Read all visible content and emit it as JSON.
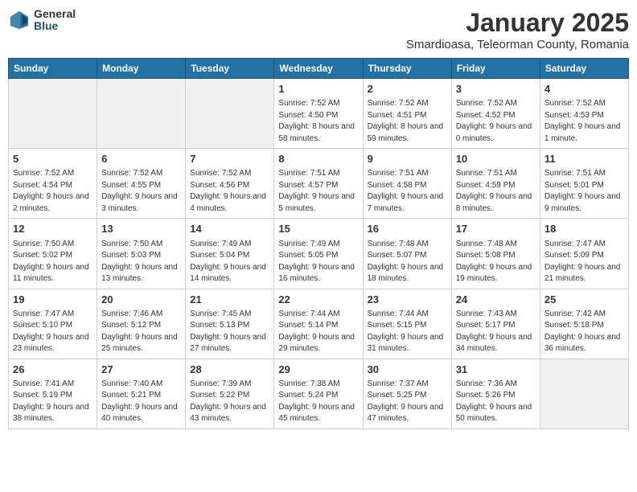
{
  "header": {
    "logo_general": "General",
    "logo_blue": "Blue",
    "month_title": "January 2025",
    "location": "Smardioasa, Teleorman County, Romania"
  },
  "weekdays": [
    "Sunday",
    "Monday",
    "Tuesday",
    "Wednesday",
    "Thursday",
    "Friday",
    "Saturday"
  ],
  "weeks": [
    [
      {
        "day": "",
        "info": ""
      },
      {
        "day": "",
        "info": ""
      },
      {
        "day": "",
        "info": ""
      },
      {
        "day": "1",
        "info": "Sunrise: 7:52 AM\nSunset: 4:50 PM\nDaylight: 8 hours and 58 minutes."
      },
      {
        "day": "2",
        "info": "Sunrise: 7:52 AM\nSunset: 4:51 PM\nDaylight: 8 hours and 59 minutes."
      },
      {
        "day": "3",
        "info": "Sunrise: 7:52 AM\nSunset: 4:52 PM\nDaylight: 9 hours and 0 minutes."
      },
      {
        "day": "4",
        "info": "Sunrise: 7:52 AM\nSunset: 4:53 PM\nDaylight: 9 hours and 1 minute."
      }
    ],
    [
      {
        "day": "5",
        "info": "Sunrise: 7:52 AM\nSunset: 4:54 PM\nDaylight: 9 hours and 2 minutes."
      },
      {
        "day": "6",
        "info": "Sunrise: 7:52 AM\nSunset: 4:55 PM\nDaylight: 9 hours and 3 minutes."
      },
      {
        "day": "7",
        "info": "Sunrise: 7:52 AM\nSunset: 4:56 PM\nDaylight: 9 hours and 4 minutes."
      },
      {
        "day": "8",
        "info": "Sunrise: 7:51 AM\nSunset: 4:57 PM\nDaylight: 9 hours and 5 minutes."
      },
      {
        "day": "9",
        "info": "Sunrise: 7:51 AM\nSunset: 4:58 PM\nDaylight: 9 hours and 7 minutes."
      },
      {
        "day": "10",
        "info": "Sunrise: 7:51 AM\nSunset: 4:59 PM\nDaylight: 9 hours and 8 minutes."
      },
      {
        "day": "11",
        "info": "Sunrise: 7:51 AM\nSunset: 5:01 PM\nDaylight: 9 hours and 9 minutes."
      }
    ],
    [
      {
        "day": "12",
        "info": "Sunrise: 7:50 AM\nSunset: 5:02 PM\nDaylight: 9 hours and 11 minutes."
      },
      {
        "day": "13",
        "info": "Sunrise: 7:50 AM\nSunset: 5:03 PM\nDaylight: 9 hours and 13 minutes."
      },
      {
        "day": "14",
        "info": "Sunrise: 7:49 AM\nSunset: 5:04 PM\nDaylight: 9 hours and 14 minutes."
      },
      {
        "day": "15",
        "info": "Sunrise: 7:49 AM\nSunset: 5:05 PM\nDaylight: 9 hours and 16 minutes."
      },
      {
        "day": "16",
        "info": "Sunrise: 7:48 AM\nSunset: 5:07 PM\nDaylight: 9 hours and 18 minutes."
      },
      {
        "day": "17",
        "info": "Sunrise: 7:48 AM\nSunset: 5:08 PM\nDaylight: 9 hours and 19 minutes."
      },
      {
        "day": "18",
        "info": "Sunrise: 7:47 AM\nSunset: 5:09 PM\nDaylight: 9 hours and 21 minutes."
      }
    ],
    [
      {
        "day": "19",
        "info": "Sunrise: 7:47 AM\nSunset: 5:10 PM\nDaylight: 9 hours and 23 minutes."
      },
      {
        "day": "20",
        "info": "Sunrise: 7:46 AM\nSunset: 5:12 PM\nDaylight: 9 hours and 25 minutes."
      },
      {
        "day": "21",
        "info": "Sunrise: 7:45 AM\nSunset: 5:13 PM\nDaylight: 9 hours and 27 minutes."
      },
      {
        "day": "22",
        "info": "Sunrise: 7:44 AM\nSunset: 5:14 PM\nDaylight: 9 hours and 29 minutes."
      },
      {
        "day": "23",
        "info": "Sunrise: 7:44 AM\nSunset: 5:15 PM\nDaylight: 9 hours and 31 minutes."
      },
      {
        "day": "24",
        "info": "Sunrise: 7:43 AM\nSunset: 5:17 PM\nDaylight: 9 hours and 34 minutes."
      },
      {
        "day": "25",
        "info": "Sunrise: 7:42 AM\nSunset: 5:18 PM\nDaylight: 9 hours and 36 minutes."
      }
    ],
    [
      {
        "day": "26",
        "info": "Sunrise: 7:41 AM\nSunset: 5:19 PM\nDaylight: 9 hours and 38 minutes."
      },
      {
        "day": "27",
        "info": "Sunrise: 7:40 AM\nSunset: 5:21 PM\nDaylight: 9 hours and 40 minutes."
      },
      {
        "day": "28",
        "info": "Sunrise: 7:39 AM\nSunset: 5:22 PM\nDaylight: 9 hours and 43 minutes."
      },
      {
        "day": "29",
        "info": "Sunrise: 7:38 AM\nSunset: 5:24 PM\nDaylight: 9 hours and 45 minutes."
      },
      {
        "day": "30",
        "info": "Sunrise: 7:37 AM\nSunset: 5:25 PM\nDaylight: 9 hours and 47 minutes."
      },
      {
        "day": "31",
        "info": "Sunrise: 7:36 AM\nSunset: 5:26 PM\nDaylight: 9 hours and 50 minutes."
      },
      {
        "day": "",
        "info": ""
      }
    ]
  ]
}
